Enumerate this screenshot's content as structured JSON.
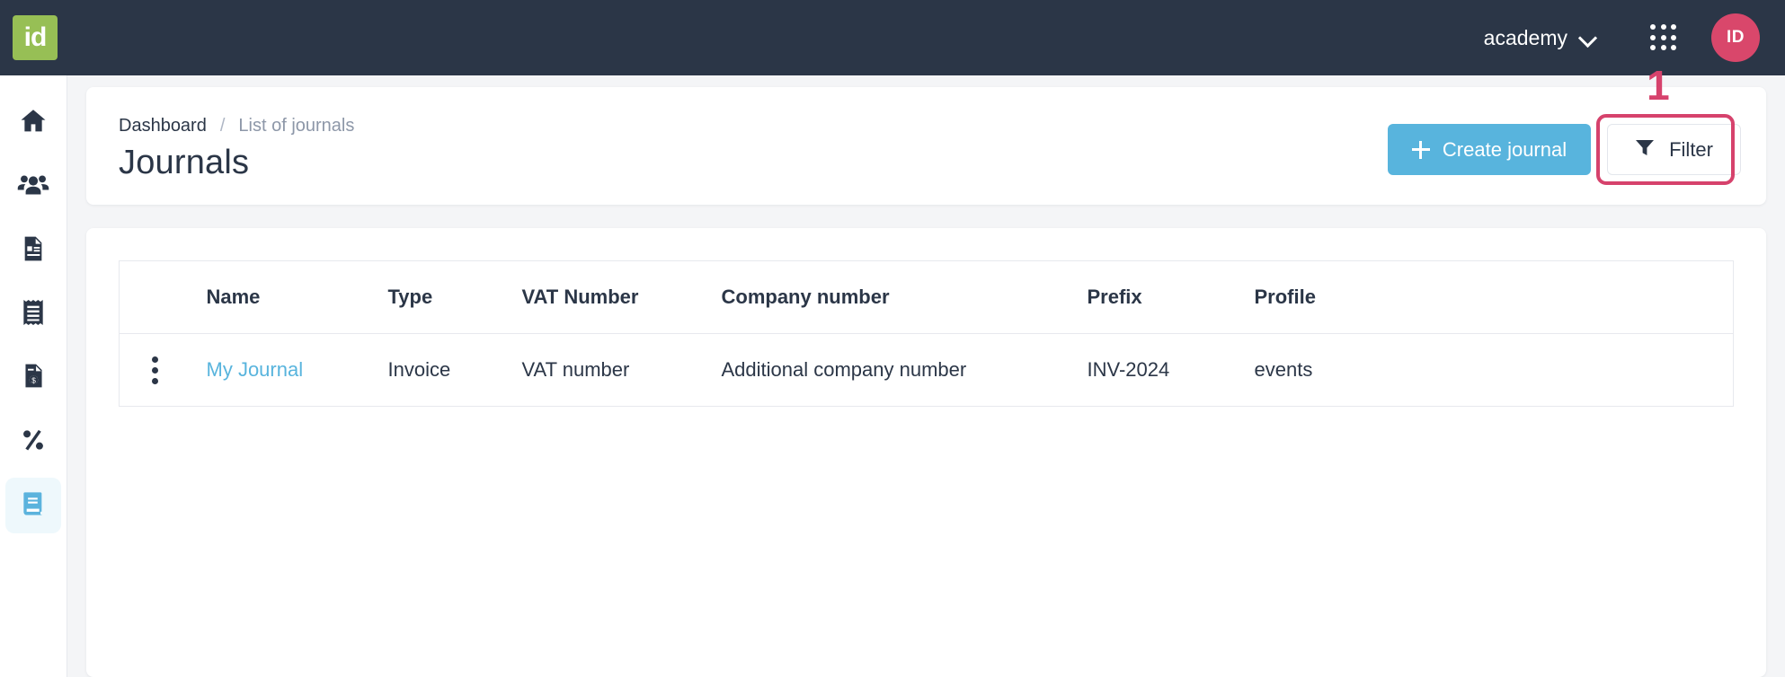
{
  "brand": {
    "logo_text": "id",
    "logo_color": "#97bf55"
  },
  "topbar": {
    "background": "#2b3647",
    "org_name": "academy",
    "apps_icon": "grid-dots-icon",
    "avatar_initials": "ID",
    "avatar_color": "#d9476b"
  },
  "sidebar": {
    "items": [
      {
        "name": "home",
        "icon": "home-icon",
        "active": false
      },
      {
        "name": "contacts",
        "icon": "people-icon",
        "active": false
      },
      {
        "name": "documents",
        "icon": "document-card-icon",
        "active": false
      },
      {
        "name": "receipts",
        "icon": "receipt-icon",
        "active": false
      },
      {
        "name": "invoices",
        "icon": "document-dollar-icon",
        "active": false
      },
      {
        "name": "taxes",
        "icon": "percent-icon",
        "active": false
      },
      {
        "name": "journals",
        "icon": "book-icon",
        "active": true
      }
    ],
    "active_color": "#5bb3dd",
    "active_background": "#eef8fc"
  },
  "header": {
    "breadcrumb": {
      "root": "Dashboard",
      "separator": "/",
      "current": "List of journals"
    },
    "title": "Journals",
    "create_button": {
      "label": "Create journal",
      "icon": "plus-icon",
      "color": "#58b4dd"
    },
    "filter_button": {
      "label": "Filter",
      "icon": "funnel-icon"
    }
  },
  "annotation": {
    "number": "1",
    "color": "#d6426c",
    "target": "filter-button"
  },
  "table": {
    "columns": [
      "Name",
      "Type",
      "VAT Number",
      "Company number",
      "Prefix",
      "Profile"
    ],
    "rows": [
      {
        "menu_icon": "kebab-menu-icon",
        "name": "My Journal",
        "type": "Invoice",
        "vat_number": "VAT number",
        "company_number": "Additional company number",
        "prefix": "INV-2024",
        "profile": "events"
      }
    ],
    "link_color": "#58b4dd"
  }
}
